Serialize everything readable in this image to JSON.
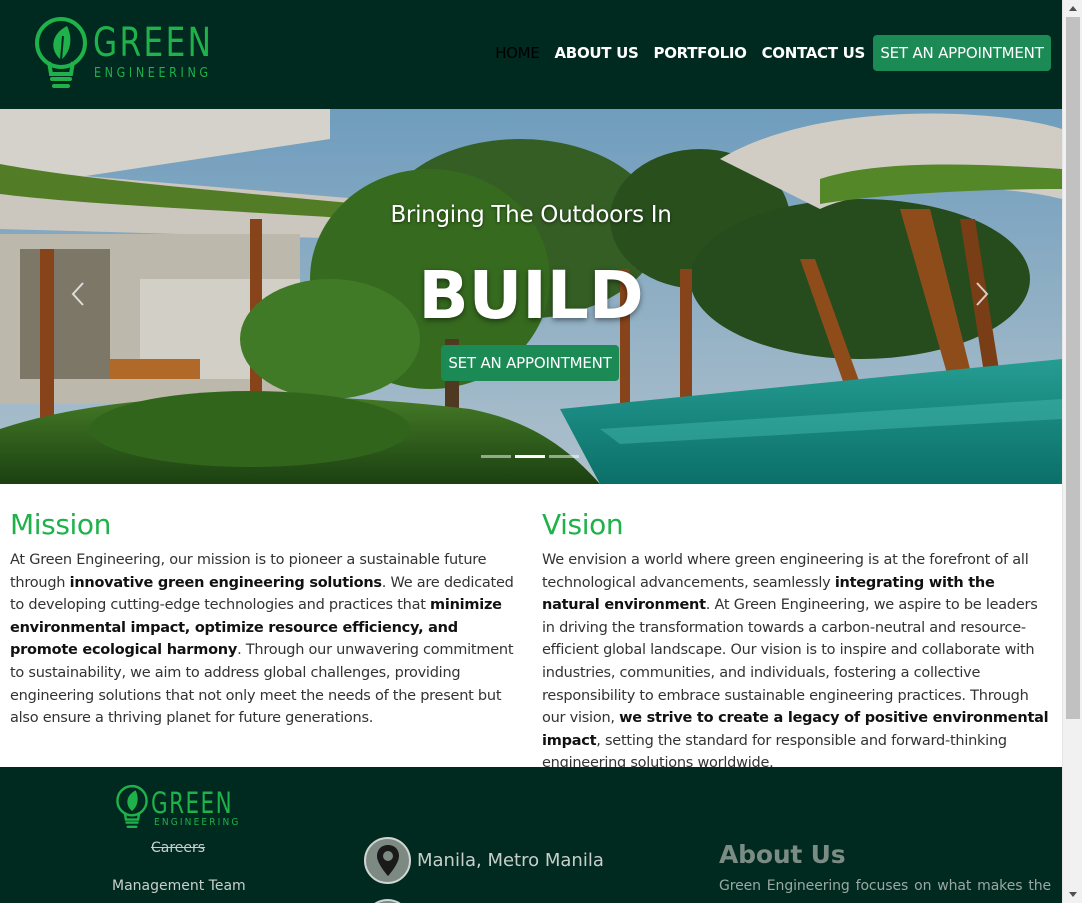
{
  "brand": {
    "name": "GREEN",
    "sub": "ENGINEERING"
  },
  "nav": {
    "links": [
      "HOME",
      "ABOUT US",
      "PORTFOLIO",
      "CONTACT US"
    ],
    "active": "HOME",
    "cta": "SET AN APPOINTMENT"
  },
  "hero": {
    "tagline": "Bringing The Outdoors In",
    "title": "BUILD",
    "cta": "SET AN APPOINTMENT",
    "slide_count": 3,
    "active_slide": 2,
    "prev_icon": "chevron-left-icon",
    "next_icon": "chevron-right-icon"
  },
  "mission": {
    "heading": "Mission",
    "segments": [
      {
        "t": "At Green Engineering, our mission is to pioneer a sustainable future through ",
        "b": false
      },
      {
        "t": "innovative green engineering solutions",
        "b": true
      },
      {
        "t": ". We are dedicated to developing cutting-edge technologies and practices that ",
        "b": false
      },
      {
        "t": "minimize environmental impact, optimize resource efficiency, and promote ecological harmony",
        "b": true
      },
      {
        "t": ". Through our unwavering commitment to sustainability, we aim to address global challenges, providing engineering solutions that not only meet the needs of the present but also ensure a thriving planet for future generations.",
        "b": false
      }
    ]
  },
  "vision": {
    "heading": "Vision",
    "segments": [
      {
        "t": "We envision a world where green engineering is at the forefront of all technological advancements, seamlessly ",
        "b": false
      },
      {
        "t": "integrating with the natural environment",
        "b": true
      },
      {
        "t": ". At Green Engineering, we aspire to be leaders in driving the transformation towards a carbon-neutral and resource-efficient global landscape. Our vision is to inspire and collaborate with industries, communities, and individuals, fostering a collective responsibility to embrace sustainable engineering practices. Through our vision, ",
        "b": false
      },
      {
        "t": "we strive to create a legacy of positive environmental impact",
        "b": true
      },
      {
        "t": ", setting the standard for responsible and forward-thinking engineering solutions worldwide.",
        "b": false
      }
    ]
  },
  "footer": {
    "brand": "GREEN",
    "brand_sub": "ENGINEERING",
    "links": {
      "careers": "Careers",
      "management": "Management Team"
    },
    "location": "Manila, Metro Manila",
    "about_heading": "About Us",
    "about_text": "Green Engineering focuses on what makes the"
  },
  "colors": {
    "nav_bg": "#00291f",
    "brand_green": "#1fb14a",
    "button_green": "#1c8a55",
    "footer_bg": "#00291f"
  }
}
